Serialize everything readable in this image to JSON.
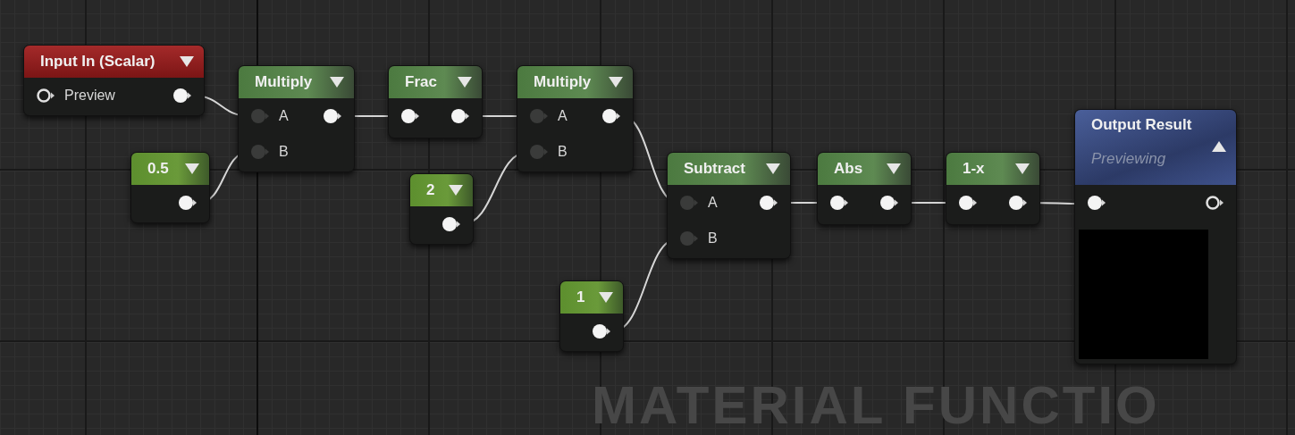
{
  "graph_label": "MATERIAL FUNCTIO",
  "nodes": [
    {
      "kind": "input",
      "title": "Input In (Scalar)",
      "preview_shown": false,
      "rows": [
        {
          "in": {
            "label": "Preview",
            "kind": "ring"
          },
          "out": {
            "kind": "filled"
          }
        }
      ]
    },
    {
      "kind": "constant",
      "title": "0.5",
      "preview_shown": false,
      "rows": [
        {
          "out": {
            "kind": "filled"
          }
        }
      ]
    },
    {
      "kind": "function",
      "title": "Multiply",
      "preview_shown": false,
      "rows": [
        {
          "in": {
            "label": "A",
            "kind": "dim"
          },
          "out": {
            "kind": "filled"
          }
        },
        {
          "in": {
            "label": "B",
            "kind": "dim"
          }
        }
      ]
    },
    {
      "kind": "function",
      "title": "Frac",
      "preview_shown": false,
      "rows": [
        {
          "in": {
            "kind": "filled"
          },
          "out": {
            "kind": "filled"
          }
        }
      ]
    },
    {
      "kind": "constant",
      "title": "2",
      "preview_shown": false,
      "rows": [
        {
          "out": {
            "kind": "filled"
          }
        }
      ]
    },
    {
      "kind": "function",
      "title": "Multiply",
      "preview_shown": false,
      "rows": [
        {
          "in": {
            "label": "A",
            "kind": "dim"
          },
          "out": {
            "kind": "filled"
          }
        },
        {
          "in": {
            "label": "B",
            "kind": "dim"
          }
        }
      ]
    },
    {
      "kind": "function",
      "title": "Subtract",
      "preview_shown": false,
      "rows": [
        {
          "in": {
            "label": "A",
            "kind": "dim"
          },
          "out": {
            "kind": "filled"
          }
        },
        {
          "in": {
            "label": "B",
            "kind": "dim"
          }
        }
      ]
    },
    {
      "kind": "constant",
      "title": "1",
      "preview_shown": false,
      "rows": [
        {
          "out": {
            "kind": "filled"
          }
        }
      ]
    },
    {
      "kind": "function",
      "title": "Abs",
      "preview_shown": false,
      "rows": [
        {
          "in": {
            "kind": "filled"
          },
          "out": {
            "kind": "filled"
          }
        }
      ]
    },
    {
      "kind": "function",
      "title": "1-x",
      "preview_shown": false,
      "rows": [
        {
          "in": {
            "kind": "filled"
          },
          "out": {
            "kind": "filled"
          }
        }
      ]
    },
    {
      "kind": "output",
      "title": "Output Result",
      "subtitle": "Previewing",
      "preview_shown": true,
      "rows": [
        {
          "in": {
            "kind": "filled"
          },
          "out": {
            "kind": "ring"
          }
        }
      ]
    }
  ]
}
